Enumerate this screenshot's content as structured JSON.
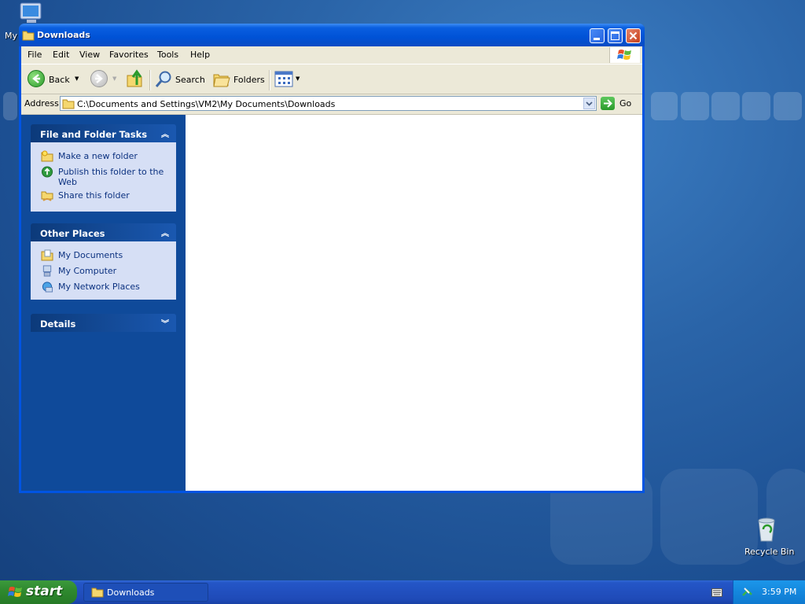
{
  "desktop": {
    "icons": [
      {
        "label": "My",
        "icon": "my-computer-icon"
      },
      {
        "label": "Recycle Bin",
        "icon": "recycle-bin-icon"
      }
    ]
  },
  "window": {
    "title": "Downloads",
    "menu": [
      "File",
      "Edit",
      "View",
      "Favorites",
      "Tools",
      "Help"
    ],
    "toolbar": {
      "back_label": "Back",
      "search_label": "Search",
      "folders_label": "Folders"
    },
    "address": {
      "label": "Address",
      "value": "C:\\Documents and Settings\\VM2\\My Documents\\Downloads",
      "go_label": "Go"
    },
    "task_pane": {
      "file_folder_tasks": {
        "title": "File and Folder Tasks",
        "items": [
          "Make a new folder",
          "Publish this folder to the Web",
          "Share this folder"
        ]
      },
      "other_places": {
        "title": "Other Places",
        "items": [
          "My Documents",
          "My Computer",
          "My Network Places"
        ]
      },
      "details": {
        "title": "Details"
      }
    }
  },
  "taskbar": {
    "start_label": "start",
    "task_button_label": "Downloads",
    "clock": "3:59 PM"
  },
  "colors": {
    "titlebar_blue": "#0054e3",
    "task_pane_blue": "#0f4a9a",
    "start_green": "#2f8a2f",
    "link_blue": "#0c3280"
  }
}
